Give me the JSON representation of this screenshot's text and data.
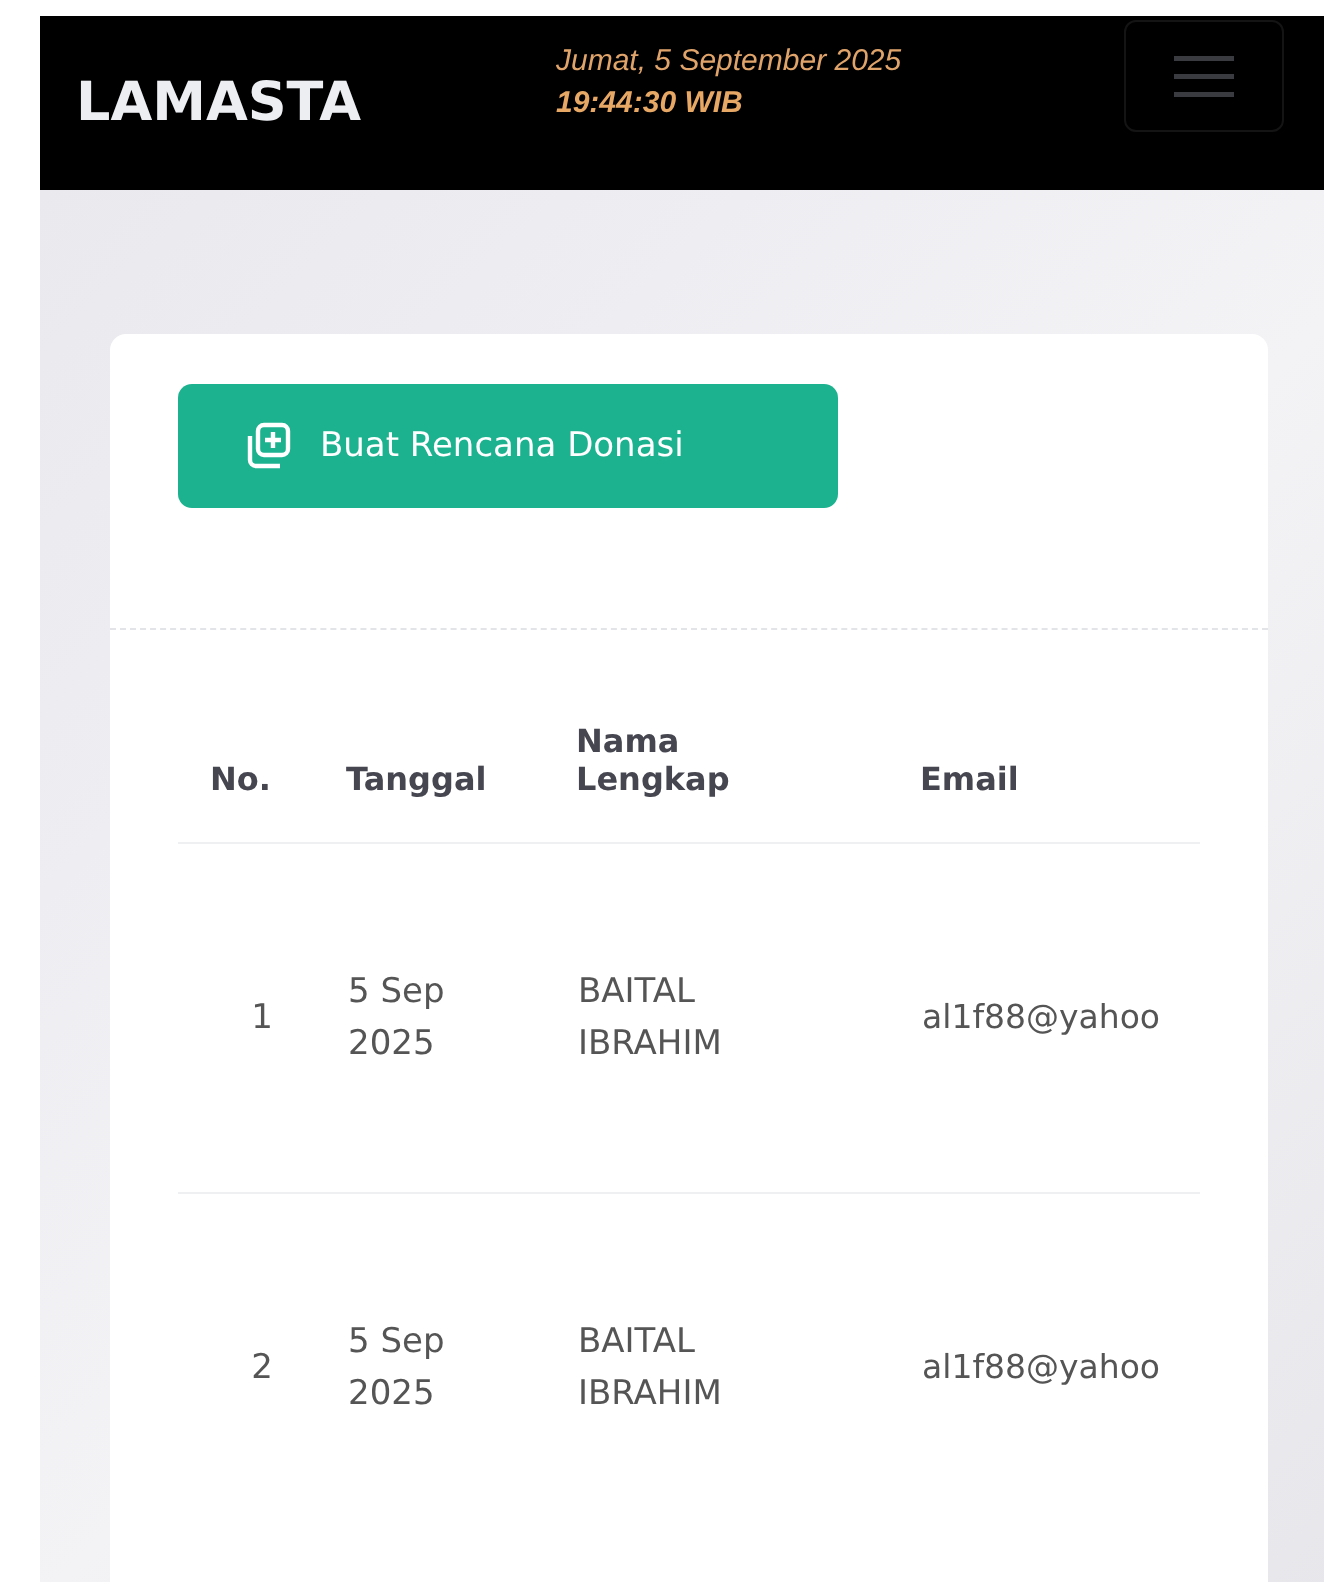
{
  "header": {
    "logo": "LAMASTA",
    "date": "Jumat, 5 September 2025",
    "time": "19:44:30 WIB"
  },
  "create_button": {
    "label": "Buat Rencana Donasi"
  },
  "table": {
    "columns": [
      "No.",
      "Tanggal",
      "Nama Lengkap",
      "Email"
    ],
    "rows": [
      {
        "no": "1",
        "date": "5 Sep 2025",
        "name": "BAITAL IBRAHIM",
        "email": "al1f88@yahoo"
      },
      {
        "no": "2",
        "date": "5 Sep 2025",
        "name": "BAITAL IBRAHIM",
        "email": "al1f88@yahoo"
      }
    ]
  }
}
